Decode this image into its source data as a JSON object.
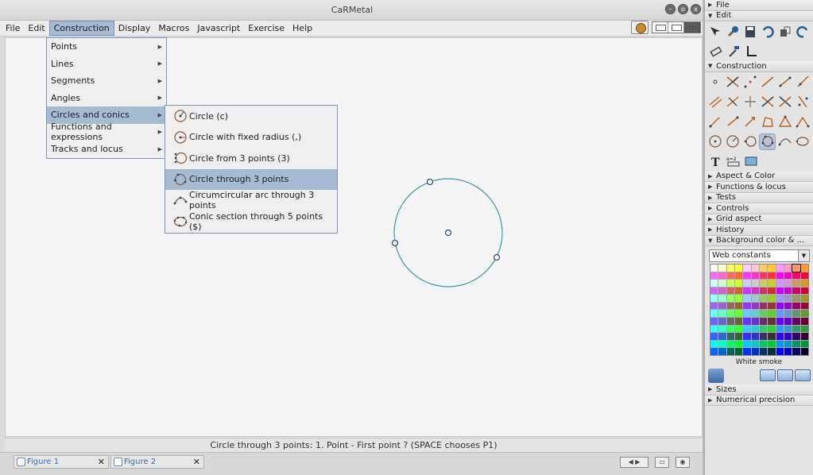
{
  "window": {
    "title": "CaRMetal"
  },
  "window_buttons": [
    "-",
    "o",
    "x"
  ],
  "menubar": [
    "File",
    "Edit",
    "Construction",
    "Display",
    "Macros",
    "Javascript",
    "Exercise",
    "Help"
  ],
  "construction_menu": [
    {
      "label": "Points",
      "selected": false
    },
    {
      "label": "Lines",
      "selected": false
    },
    {
      "label": "Segments",
      "selected": false
    },
    {
      "label": "Angles",
      "selected": false
    },
    {
      "label": "Circles and conics",
      "selected": true
    },
    {
      "label": "Functions and expressions",
      "selected": false
    },
    {
      "label": "Tracks and locus",
      "selected": false
    }
  ],
  "circles_submenu": [
    {
      "label": "Circle (c)",
      "icon": "circle-icon",
      "selected": false
    },
    {
      "label": "Circle with fixed radius (,)",
      "icon": "fixed-circle-icon",
      "selected": false
    },
    {
      "label": "Circle from 3 points (3)",
      "icon": "circle-3pts-icon",
      "selected": false
    },
    {
      "label": "Circle through 3 points",
      "icon": "circle-through-3pts-icon",
      "selected": true
    },
    {
      "label": "Circumcircular arc through 3 points",
      "icon": "arc-icon",
      "selected": false
    },
    {
      "label": "Conic section through 5 points ($)",
      "icon": "conic-icon",
      "selected": false
    }
  ],
  "status": "Circle through 3 points: 1. Point - First point ?  (SPACE chooses P1)",
  "tabs": [
    {
      "label": "Figure 1"
    },
    {
      "label": "Figure 2"
    }
  ],
  "panel": {
    "sections_top": [
      {
        "label": "File",
        "expanded": false
      },
      {
        "label": "Edit",
        "expanded": true
      }
    ],
    "construction_label": "Construction",
    "sections_mid": [
      {
        "label": "Aspect & Color",
        "expanded": false
      },
      {
        "label": "Functions & locus",
        "expanded": false
      },
      {
        "label": "Tests",
        "expanded": false
      },
      {
        "label": "Controls",
        "expanded": false
      },
      {
        "label": "Grid aspect",
        "expanded": false
      },
      {
        "label": "History",
        "expanded": false
      },
      {
        "label": "Background color & ...",
        "expanded": true
      }
    ],
    "web_constants": "Web constants",
    "color_name": "White smoke",
    "sections_bottom": [
      {
        "label": "Sizes",
        "expanded": false
      },
      {
        "label": "Numerical precision",
        "expanded": false
      }
    ]
  },
  "colors": {
    "accent": "#a6bad2",
    "circle": "#3d9aa0",
    "point": "#2c3e8c"
  }
}
